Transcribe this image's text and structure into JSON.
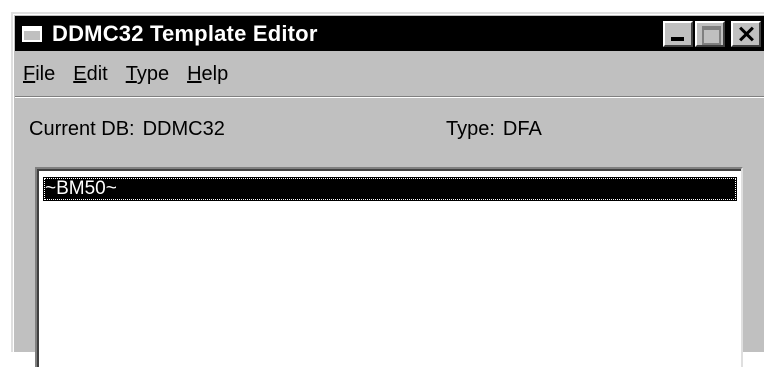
{
  "window": {
    "title": "DDMC32 Template Editor",
    "title_icon": "window-icon",
    "controls": [
      "minimize-icon",
      "maximize-icon",
      "close-icon"
    ]
  },
  "menu": {
    "file": {
      "accel": "F",
      "rest": "ile"
    },
    "edit": {
      "accel": "E",
      "rest": "dit"
    },
    "type": {
      "accel": "T",
      "rest": "ype"
    },
    "help": {
      "accel": "H",
      "rest": "elp"
    }
  },
  "info": {
    "db_label": "Current DB:",
    "db_value": "DDMC32",
    "type_label": "Type:",
    "type_value": "DFA"
  },
  "templates": {
    "items": [
      "~BM50~"
    ],
    "selected_index": 0
  },
  "colors": {
    "face": "#c0c0c0",
    "title_bg": "#000000",
    "selection_bg": "#000000",
    "selection_fg": "#ffffff"
  }
}
